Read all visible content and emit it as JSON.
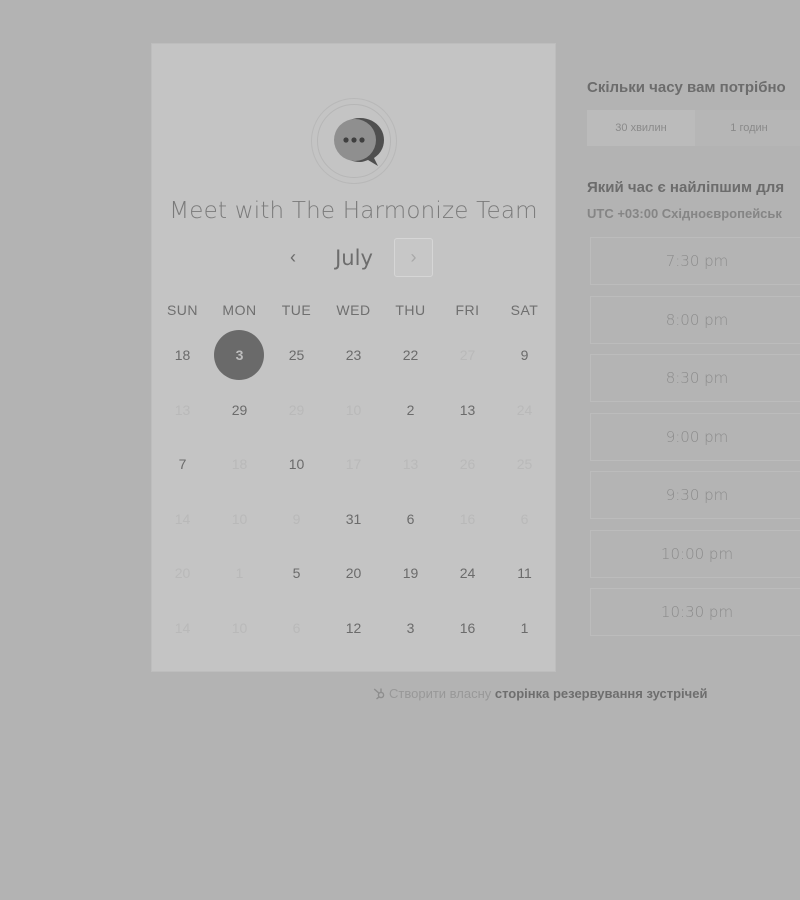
{
  "left_card": {
    "title": "Meet with The Harmonize Team",
    "month": "July",
    "prev_glyph": "‹",
    "next_glyph": "›",
    "weekdays": [
      "SUN",
      "MON",
      "TUE",
      "WED",
      "THU",
      "FRI",
      "SAT"
    ],
    "weeks": [
      [
        {
          "d": "18",
          "on": true
        },
        {
          "d": "3",
          "on": true,
          "selected": true
        },
        {
          "d": "25",
          "on": true
        },
        {
          "d": "23",
          "on": true
        },
        {
          "d": "22",
          "on": true
        },
        {
          "d": "27",
          "on": false
        },
        {
          "d": "9",
          "on": true
        }
      ],
      [
        {
          "d": "13",
          "on": false
        },
        {
          "d": "29",
          "on": true
        },
        {
          "d": "29",
          "on": false
        },
        {
          "d": "10",
          "on": false
        },
        {
          "d": "2",
          "on": true
        },
        {
          "d": "13",
          "on": true
        },
        {
          "d": "24",
          "on": false
        }
      ],
      [
        {
          "d": "7",
          "on": true
        },
        {
          "d": "18",
          "on": false
        },
        {
          "d": "10",
          "on": true
        },
        {
          "d": "17",
          "on": false
        },
        {
          "d": "13",
          "on": false
        },
        {
          "d": "26",
          "on": false
        },
        {
          "d": "25",
          "on": false
        }
      ],
      [
        {
          "d": "14",
          "on": false
        },
        {
          "d": "10",
          "on": false
        },
        {
          "d": "9",
          "on": false
        },
        {
          "d": "31",
          "on": true
        },
        {
          "d": "6",
          "on": true
        },
        {
          "d": "16",
          "on": false
        },
        {
          "d": "6",
          "on": false
        }
      ],
      [
        {
          "d": "20",
          "on": false
        },
        {
          "d": "1",
          "on": false
        },
        {
          "d": "5",
          "on": true
        },
        {
          "d": "20",
          "on": true
        },
        {
          "d": "19",
          "on": true
        },
        {
          "d": "24",
          "on": true
        },
        {
          "d": "11",
          "on": true
        }
      ],
      [
        {
          "d": "14",
          "on": false
        },
        {
          "d": "10",
          "on": false
        },
        {
          "d": "6",
          "on": false
        },
        {
          "d": "12",
          "on": true
        },
        {
          "d": "3",
          "on": true
        },
        {
          "d": "16",
          "on": true
        },
        {
          "d": "1",
          "on": true
        }
      ]
    ]
  },
  "right_panel": {
    "duration_question": "Скільки часу вам потрібно",
    "durations": [
      "30 хвилин",
      "1 годин"
    ],
    "time_question": "Який час є найліпшим для",
    "timezone": "UTC +03:00 Східноєвропейськ",
    "slots": [
      "7:30 pm",
      "8:00 pm",
      "8:30 pm",
      "9:00 pm",
      "9:30 pm",
      "10:00 pm",
      "10:30 pm"
    ]
  },
  "footer": {
    "prefix": "Створити власну ",
    "link": "сторінка резервування зустрічей"
  },
  "colors": {
    "background": "#b3b3b3",
    "card": "#c4c4c4",
    "selected_day": "#6a6a6a"
  },
  "icons": {
    "logo": "chat-bubble-logo-icon",
    "footer": "hubspot-sprocket-icon"
  }
}
